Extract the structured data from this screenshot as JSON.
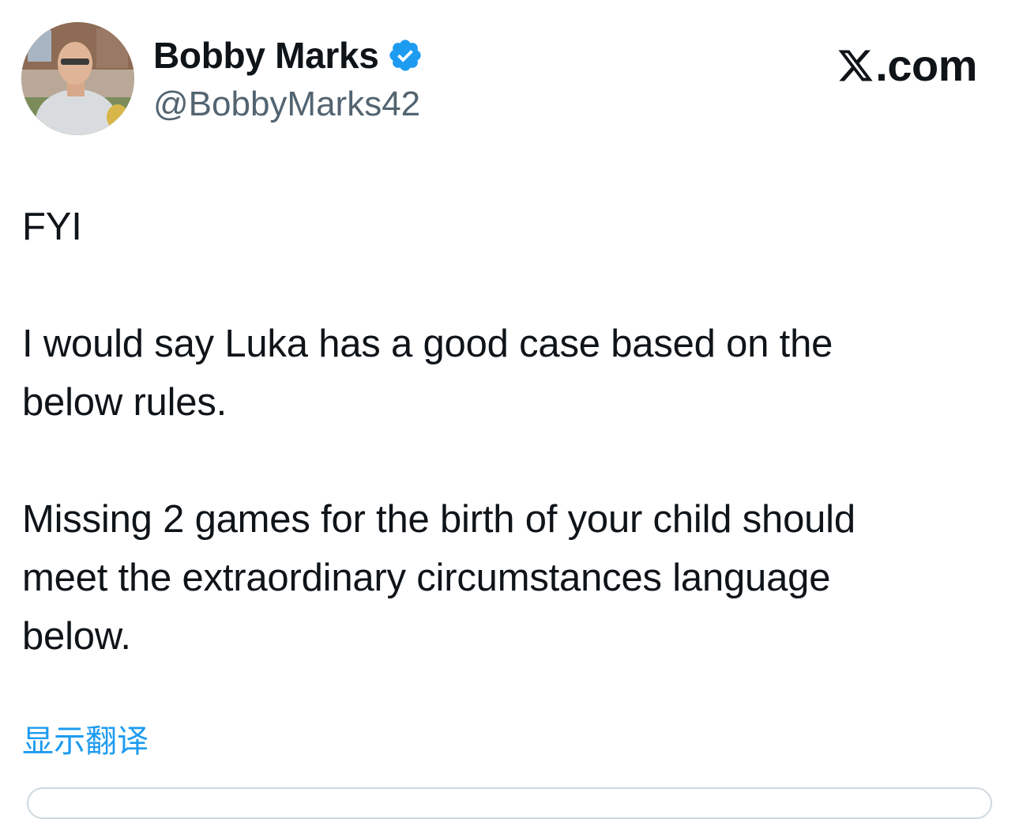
{
  "header": {
    "display_name": "Bobby Marks",
    "handle": "@BobbyMarks42",
    "verified": true,
    "brand_text": ".com",
    "verified_color": "#1d9bf0"
  },
  "tweet": {
    "paragraphs": [
      "FYI",
      "I would say Luka has a good case based on the\nbelow rules.",
      "Missing 2 games for the birth of your child should\nmeet the extraordinary circumstances language\nbelow."
    ],
    "translate_label": "显示翻译"
  },
  "colors": {
    "text": "#0f1419",
    "secondary_text": "#536471",
    "link": "#1d9bf0",
    "border": "#cfd9de"
  },
  "icons": {
    "verified": "verified-badge-icon",
    "brand": "x-logo-icon"
  }
}
